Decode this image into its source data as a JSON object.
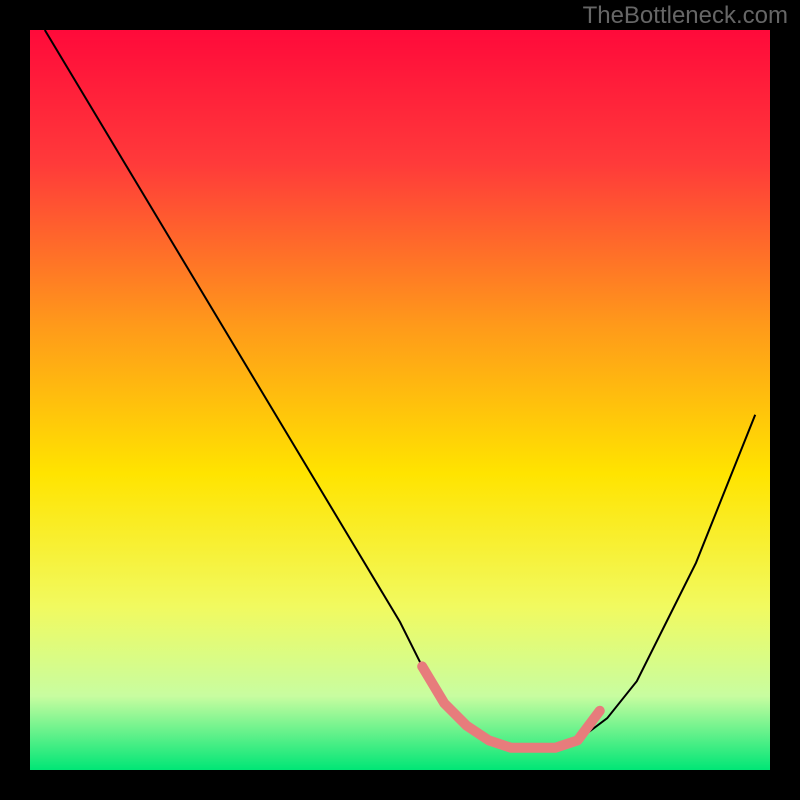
{
  "watermark": "TheBottleneck.com",
  "chart_data": {
    "type": "line",
    "title": "",
    "xlabel": "",
    "ylabel": "",
    "xlim": [
      0,
      100
    ],
    "ylim": [
      0,
      100
    ],
    "gradient_stops": [
      {
        "offset": 0,
        "color": "#ff0a3a"
      },
      {
        "offset": 18,
        "color": "#ff3a3a"
      },
      {
        "offset": 40,
        "color": "#ff9a1a"
      },
      {
        "offset": 60,
        "color": "#ffe400"
      },
      {
        "offset": 78,
        "color": "#f1fa60"
      },
      {
        "offset": 90,
        "color": "#c8fda0"
      },
      {
        "offset": 100,
        "color": "#00e676"
      }
    ],
    "series": [
      {
        "name": "bottleneck-curve",
        "color": "#000000",
        "width": 2,
        "x": [
          2,
          8,
          14,
          20,
          26,
          32,
          38,
          44,
          50,
          53,
          56,
          59,
          62,
          65,
          68,
          71,
          74,
          78,
          82,
          86,
          90,
          94,
          98
        ],
        "values": [
          100,
          90,
          80,
          70,
          60,
          50,
          40,
          30,
          20,
          14,
          9,
          6,
          4,
          3,
          3,
          3,
          4,
          7,
          12,
          20,
          28,
          38,
          48
        ]
      },
      {
        "name": "sweet-spot",
        "color": "#e77c7c",
        "width": 10,
        "linecap": "round",
        "x": [
          53,
          56,
          59,
          62,
          65,
          68,
          71,
          74,
          77
        ],
        "values": [
          14,
          9,
          6,
          4,
          3,
          3,
          3,
          4,
          8
        ]
      }
    ]
  }
}
